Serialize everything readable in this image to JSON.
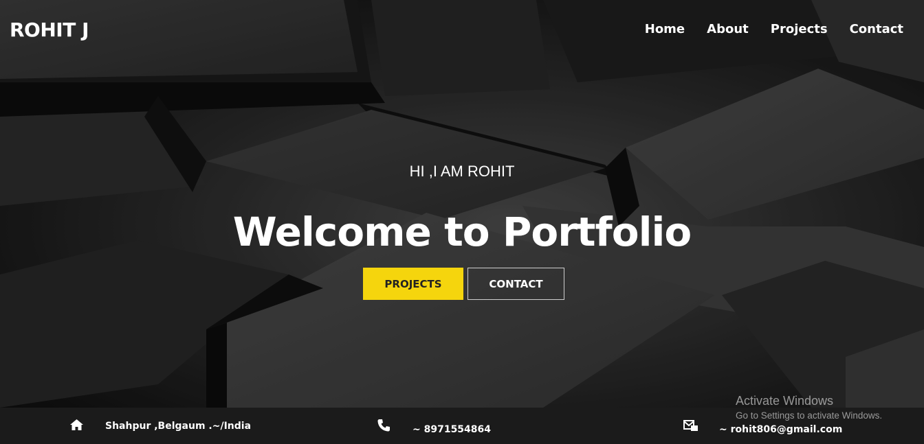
{
  "brand": {
    "name": "ROHIT J"
  },
  "nav": {
    "items": [
      {
        "label": "Home"
      },
      {
        "label": "About"
      },
      {
        "label": "Projects"
      },
      {
        "label": "Contact"
      }
    ]
  },
  "hero": {
    "greeting": "HI ,I AM ROHIT",
    "title": "Welcome to Portfolio",
    "primary_button": "PROJECTS",
    "secondary_button": "CONTACT",
    "accent_color": "#f5d50d"
  },
  "footer": {
    "address": {
      "icon": "home-icon",
      "text": "Shahpur ,Belgaum .~/India"
    },
    "phone": {
      "icon": "phone-icon",
      "text": "~ 8971554864"
    },
    "email": {
      "icon": "email-icon",
      "text": "~ rohit806@gmail.com"
    }
  },
  "watermark": {
    "line1": "Activate Windows",
    "line2": "Go to Settings to activate Windows."
  }
}
